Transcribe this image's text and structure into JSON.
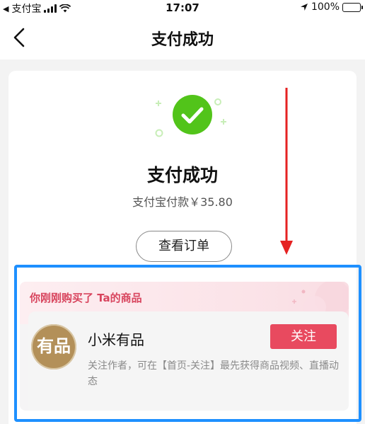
{
  "status_bar": {
    "carrier": "支付宝",
    "time": "17:07",
    "battery": "100%"
  },
  "nav": {
    "title": "支付成功"
  },
  "result": {
    "title": "支付成功",
    "amount_text": "支付宝付款￥35.80",
    "view_order_label": "查看订单"
  },
  "recent": {
    "heading": "你刚刚购买了 Ta的商品",
    "shop": {
      "avatar_text": "有品",
      "name": "小米有品",
      "follow_label": "关注",
      "description": "关注作者，可在【首页-关注】最先获得商品视频、直播动态"
    }
  },
  "colors": {
    "accent_red": "#e84a5f",
    "success_green": "#52c41a",
    "highlight_blue": "#1e90ff"
  },
  "icons": [
    "back-arrow-icon",
    "signal-icon",
    "wifi-icon",
    "location-icon",
    "battery-icon",
    "check-circle-icon"
  ]
}
